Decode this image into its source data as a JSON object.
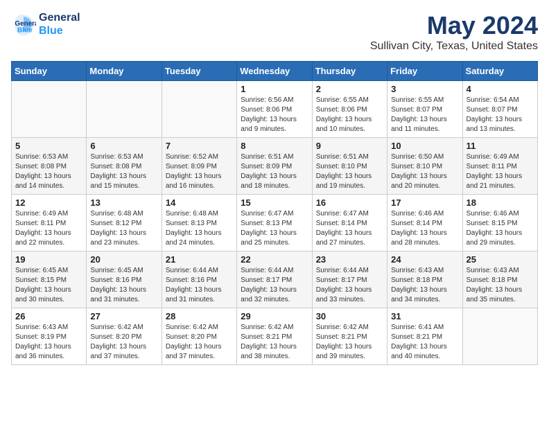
{
  "header": {
    "logo_line1": "General",
    "logo_line2": "Blue",
    "month": "May 2024",
    "location": "Sullivan City, Texas, United States"
  },
  "days_of_week": [
    "Sunday",
    "Monday",
    "Tuesday",
    "Wednesday",
    "Thursday",
    "Friday",
    "Saturday"
  ],
  "weeks": [
    [
      {
        "day": "",
        "info": ""
      },
      {
        "day": "",
        "info": ""
      },
      {
        "day": "",
        "info": ""
      },
      {
        "day": "1",
        "info": "Sunrise: 6:56 AM\nSunset: 8:06 PM\nDaylight: 13 hours\nand 9 minutes."
      },
      {
        "day": "2",
        "info": "Sunrise: 6:55 AM\nSunset: 8:06 PM\nDaylight: 13 hours\nand 10 minutes."
      },
      {
        "day": "3",
        "info": "Sunrise: 6:55 AM\nSunset: 8:07 PM\nDaylight: 13 hours\nand 11 minutes."
      },
      {
        "day": "4",
        "info": "Sunrise: 6:54 AM\nSunset: 8:07 PM\nDaylight: 13 hours\nand 13 minutes."
      }
    ],
    [
      {
        "day": "5",
        "info": "Sunrise: 6:53 AM\nSunset: 8:08 PM\nDaylight: 13 hours\nand 14 minutes."
      },
      {
        "day": "6",
        "info": "Sunrise: 6:53 AM\nSunset: 8:08 PM\nDaylight: 13 hours\nand 15 minutes."
      },
      {
        "day": "7",
        "info": "Sunrise: 6:52 AM\nSunset: 8:09 PM\nDaylight: 13 hours\nand 16 minutes."
      },
      {
        "day": "8",
        "info": "Sunrise: 6:51 AM\nSunset: 8:09 PM\nDaylight: 13 hours\nand 18 minutes."
      },
      {
        "day": "9",
        "info": "Sunrise: 6:51 AM\nSunset: 8:10 PM\nDaylight: 13 hours\nand 19 minutes."
      },
      {
        "day": "10",
        "info": "Sunrise: 6:50 AM\nSunset: 8:10 PM\nDaylight: 13 hours\nand 20 minutes."
      },
      {
        "day": "11",
        "info": "Sunrise: 6:49 AM\nSunset: 8:11 PM\nDaylight: 13 hours\nand 21 minutes."
      }
    ],
    [
      {
        "day": "12",
        "info": "Sunrise: 6:49 AM\nSunset: 8:11 PM\nDaylight: 13 hours\nand 22 minutes."
      },
      {
        "day": "13",
        "info": "Sunrise: 6:48 AM\nSunset: 8:12 PM\nDaylight: 13 hours\nand 23 minutes."
      },
      {
        "day": "14",
        "info": "Sunrise: 6:48 AM\nSunset: 8:13 PM\nDaylight: 13 hours\nand 24 minutes."
      },
      {
        "day": "15",
        "info": "Sunrise: 6:47 AM\nSunset: 8:13 PM\nDaylight: 13 hours\nand 25 minutes."
      },
      {
        "day": "16",
        "info": "Sunrise: 6:47 AM\nSunset: 8:14 PM\nDaylight: 13 hours\nand 27 minutes."
      },
      {
        "day": "17",
        "info": "Sunrise: 6:46 AM\nSunset: 8:14 PM\nDaylight: 13 hours\nand 28 minutes."
      },
      {
        "day": "18",
        "info": "Sunrise: 6:46 AM\nSunset: 8:15 PM\nDaylight: 13 hours\nand 29 minutes."
      }
    ],
    [
      {
        "day": "19",
        "info": "Sunrise: 6:45 AM\nSunset: 8:15 PM\nDaylight: 13 hours\nand 30 minutes."
      },
      {
        "day": "20",
        "info": "Sunrise: 6:45 AM\nSunset: 8:16 PM\nDaylight: 13 hours\nand 31 minutes."
      },
      {
        "day": "21",
        "info": "Sunrise: 6:44 AM\nSunset: 8:16 PM\nDaylight: 13 hours\nand 31 minutes."
      },
      {
        "day": "22",
        "info": "Sunrise: 6:44 AM\nSunset: 8:17 PM\nDaylight: 13 hours\nand 32 minutes."
      },
      {
        "day": "23",
        "info": "Sunrise: 6:44 AM\nSunset: 8:17 PM\nDaylight: 13 hours\nand 33 minutes."
      },
      {
        "day": "24",
        "info": "Sunrise: 6:43 AM\nSunset: 8:18 PM\nDaylight: 13 hours\nand 34 minutes."
      },
      {
        "day": "25",
        "info": "Sunrise: 6:43 AM\nSunset: 8:18 PM\nDaylight: 13 hours\nand 35 minutes."
      }
    ],
    [
      {
        "day": "26",
        "info": "Sunrise: 6:43 AM\nSunset: 8:19 PM\nDaylight: 13 hours\nand 36 minutes."
      },
      {
        "day": "27",
        "info": "Sunrise: 6:42 AM\nSunset: 8:20 PM\nDaylight: 13 hours\nand 37 minutes."
      },
      {
        "day": "28",
        "info": "Sunrise: 6:42 AM\nSunset: 8:20 PM\nDaylight: 13 hours\nand 37 minutes."
      },
      {
        "day": "29",
        "info": "Sunrise: 6:42 AM\nSunset: 8:21 PM\nDaylight: 13 hours\nand 38 minutes."
      },
      {
        "day": "30",
        "info": "Sunrise: 6:42 AM\nSunset: 8:21 PM\nDaylight: 13 hours\nand 39 minutes."
      },
      {
        "day": "31",
        "info": "Sunrise: 6:41 AM\nSunset: 8:21 PM\nDaylight: 13 hours\nand 40 minutes."
      },
      {
        "day": "",
        "info": ""
      }
    ]
  ]
}
